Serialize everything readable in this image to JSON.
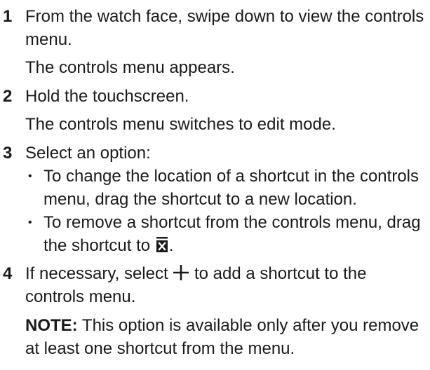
{
  "steps": [
    {
      "number": "1",
      "text": "From the watch face, swipe down to view the controls menu.",
      "result": "The controls menu appears."
    },
    {
      "number": "2",
      "text": "Hold the touchscreen.",
      "result": "The controls menu switches to edit mode."
    },
    {
      "number": "3",
      "text": "Select an option:",
      "bullets": [
        {
          "text": "To change the location of a shortcut in the controls menu, drag the shortcut to a new location."
        },
        {
          "text_before_icon": "To remove a shortcut from the controls menu, drag the shortcut to",
          "icon": "remove-box-icon",
          "text_after_icon": "."
        }
      ]
    },
    {
      "number": "4",
      "text_before_icon": "If necessary, select",
      "icon": "plus-icon",
      "text_after_icon": "to add a shortcut to the controls menu.",
      "note_label": "NOTE:",
      "note_text": "This option is available only after you remove at least one shortcut from the menu."
    }
  ],
  "bullet_glyph": "•"
}
